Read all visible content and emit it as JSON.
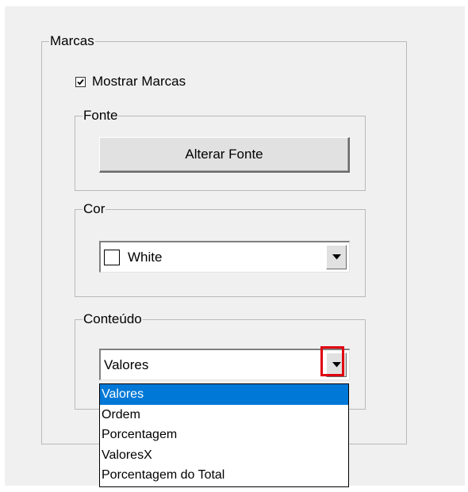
{
  "marcas": {
    "label": "Marcas",
    "show_marks": {
      "label": "Mostrar Marcas",
      "checked": true
    }
  },
  "fonte": {
    "label": "Fonte",
    "button_label": "Alterar Fonte"
  },
  "cor": {
    "label": "Cor",
    "selected": "White",
    "swatch_color": "#ffffff"
  },
  "conteudo": {
    "label": "Conteúdo",
    "selected": "Valores",
    "options": [
      "Valores",
      "Ordem",
      "Porcentagem",
      "ValoresX",
      "Porcentagem do Total"
    ]
  },
  "colors": {
    "selection_bg": "#0078d7",
    "highlight_border": "#e0000f",
    "panel_bg": "#f0f0f0"
  }
}
